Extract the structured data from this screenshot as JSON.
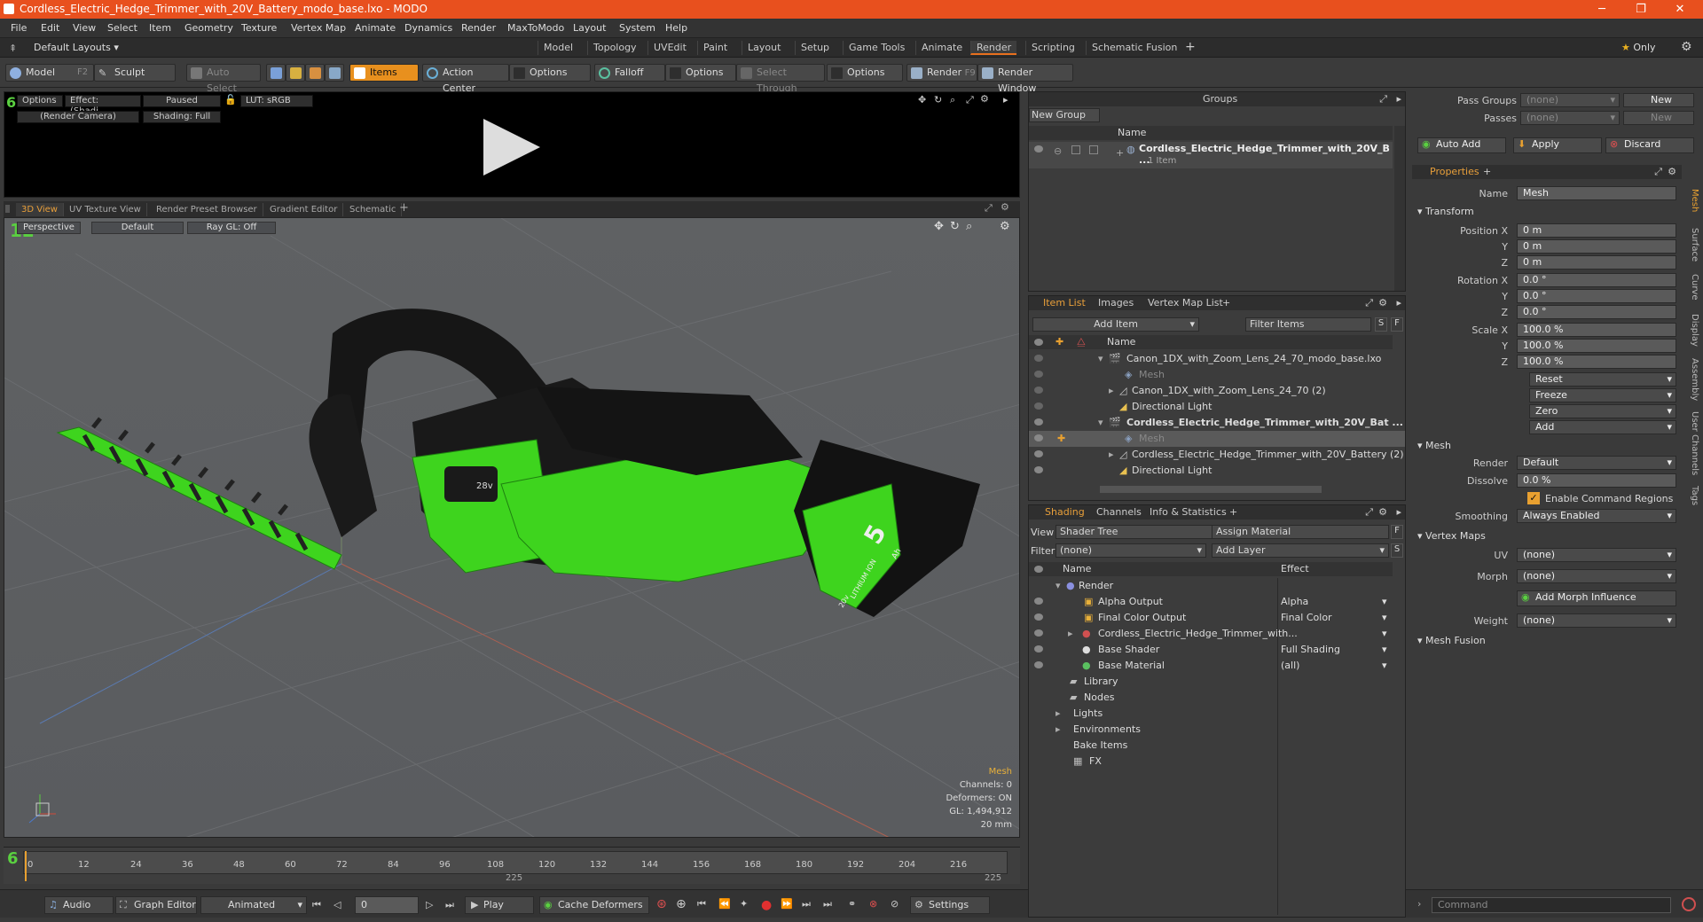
{
  "window": {
    "title": "Cordless_Electric_Hedge_Trimmer_with_20V_Battery_modo_base.lxo - MODO"
  },
  "menu": [
    "File",
    "Edit",
    "View",
    "Select",
    "Item",
    "Geometry",
    "Texture",
    "Vertex Map",
    "Animate",
    "Dynamics",
    "Render",
    "MaxToModo",
    "Layout",
    "System",
    "Help"
  ],
  "layouts": {
    "label": "Default Layouts",
    "tabs": [
      "Model",
      "Topology",
      "UVEdit",
      "Paint",
      "Layout",
      "Setup",
      "Game Tools",
      "Animate",
      "Render",
      "Scripting",
      "Schematic Fusion"
    ],
    "active": "Render",
    "only": "Only"
  },
  "toolbar": {
    "model": "Model",
    "model_key": "F2",
    "sculpt": "Sculpt",
    "auto_select": "Auto Select",
    "items": "Items",
    "action_center": "Action Center",
    "options1": "Options",
    "falloff": "Falloff",
    "options2": "Options",
    "select_through": "Select Through",
    "options3": "Options",
    "render": "Render",
    "render_key": "F9",
    "render_window": "Render Window"
  },
  "preview": {
    "options": "Options",
    "effect": "Effect: (Shadi...",
    "paused": "Paused",
    "lut": "LUT: sRGB",
    "camera": "(Render Camera)",
    "shading": "Shading: Full"
  },
  "viewtabs": [
    "3D View",
    "UV Texture View",
    "Render Preset Browser",
    "Gradient Editor",
    "Schematic"
  ],
  "viewport": {
    "perspective": "Perspective",
    "default": "Default",
    "raygl": "Ray GL: Off",
    "badge": "28v",
    "battery_big": "5",
    "battery_unit": "Ah",
    "battery_label": "LITHIUM ION",
    "battery_v": "20v",
    "info": [
      "Mesh",
      "Channels: 0",
      "Deformers: ON",
      "GL: 1,494,912",
      "20 mm"
    ]
  },
  "timeline": {
    "ticks": [
      "0",
      "12",
      "24",
      "36",
      "48",
      "60",
      "72",
      "84",
      "96",
      "108",
      "120",
      "132",
      "144",
      "156",
      "168",
      "180",
      "192",
      "204",
      "216"
    ],
    "mid": "225",
    "end": "225"
  },
  "bottom": {
    "audio": "Audio",
    "graph": "Graph Editor",
    "animated": "Animated",
    "frame": "0",
    "play": "Play",
    "cache": "Cache Deformers",
    "settings": "Settings",
    "command": "Command"
  },
  "groups": {
    "title": "Groups",
    "new_group": "New Group",
    "name_col": "Name",
    "item": "Cordless_Electric_Hedge_Trimmer_with_20V_B ...",
    "count": "1 Item"
  },
  "itemlist": {
    "tabs": [
      "Item List",
      "Images",
      "Vertex Map List"
    ],
    "add_item": "Add Item",
    "filter": "Filter Items",
    "name_col": "Name",
    "rows": [
      {
        "t": "Canon_1DX_with_Zoom_Lens_24_70_modo_base.lxo",
        "ind": 0,
        "bold": false
      },
      {
        "t": "Mesh",
        "ind": 2,
        "bold": false,
        "dim": true
      },
      {
        "t": "Canon_1DX_with_Zoom_Lens_24_70 (2)",
        "ind": 1,
        "bold": false
      },
      {
        "t": "Directional Light",
        "ind": 1,
        "bold": false
      },
      {
        "t": "Cordless_Electric_Hedge_Trimmer_with_20V_Bat ...",
        "ind": 0,
        "bold": true
      },
      {
        "t": "Mesh",
        "ind": 2,
        "bold": false,
        "dim": true,
        "sel": true
      },
      {
        "t": "Cordless_Electric_Hedge_Trimmer_with_20V_Battery (2)",
        "ind": 1,
        "bold": false
      },
      {
        "t": "Directional Light",
        "ind": 1,
        "bold": false
      }
    ]
  },
  "shading": {
    "tabs": [
      "Shading",
      "Channels",
      "Info & Statistics"
    ],
    "view_label": "View",
    "view": "Shader Tree",
    "assign": "Assign Material",
    "filter_label": "Filter",
    "filter": "(none)",
    "add_layer": "Add Layer",
    "name_col": "Name",
    "effect_col": "Effect",
    "rows": [
      {
        "t": "Render",
        "e": "",
        "ind": 0
      },
      {
        "t": "Alpha Output",
        "e": "Alpha",
        "ind": 1
      },
      {
        "t": "Final Color Output",
        "e": "Final Color",
        "ind": 1
      },
      {
        "t": "Cordless_Electric_Hedge_Trimmer_with...",
        "e": "",
        "ind": 1
      },
      {
        "t": "Base Shader",
        "e": "Full Shading",
        "ind": 1
      },
      {
        "t": "Base Material",
        "e": "(all)",
        "ind": 1
      },
      {
        "t": "Library",
        "e": "",
        "ind": 0
      },
      {
        "t": "Nodes",
        "e": "",
        "ind": 0
      },
      {
        "t": "Lights",
        "e": "",
        "ind": -1
      },
      {
        "t": "Environments",
        "e": "",
        "ind": -1
      },
      {
        "t": "Bake Items",
        "e": "",
        "ind": -1
      },
      {
        "t": "FX",
        "e": "",
        "ind": -1
      }
    ]
  },
  "passes": {
    "pass_groups": "Pass Groups",
    "pass_groups_val": "(none)",
    "new1": "New",
    "passes": "Passes",
    "passes_val": "(none)",
    "new2": "New",
    "auto_add": "Auto Add",
    "apply": "Apply",
    "discard": "Discard"
  },
  "properties": {
    "title": "Properties",
    "name_label": "Name",
    "name": "Mesh",
    "transform": "Transform",
    "pos_label": "Position X",
    "pos": [
      "0 m",
      "0 m",
      "0 m"
    ],
    "rot_label": "Rotation X",
    "rot": [
      "0.0 °",
      "0.0 °",
      "0.0 °"
    ],
    "scale_label": "Scale X",
    "scale": [
      "100.0 %",
      "100.0 %",
      "100.0 %"
    ],
    "yz": [
      "Y",
      "Z"
    ],
    "reset": "Reset",
    "freeze": "Freeze",
    "zero": "Zero",
    "add": "Add",
    "mesh": "Mesh",
    "render_label": "Render",
    "render": "Default",
    "dissolve_label": "Dissolve",
    "dissolve": "0.0 %",
    "enable_cmd": "Enable Command Regions",
    "smoothing_label": "Smoothing",
    "smoothing": "Always Enabled",
    "vertex_maps": "Vertex Maps",
    "uv_label": "UV",
    "uv": "(none)",
    "morph_label": "Morph",
    "morph": "(none)",
    "add_morph": "Add Morph Influence",
    "weight_label": "Weight",
    "weight": "(none)",
    "mesh_fusion": "Mesh Fusion",
    "sidetabs": [
      "Mesh",
      "Surface",
      "Curve",
      "Display",
      "Assembly",
      "User Channels",
      "Tags"
    ]
  }
}
